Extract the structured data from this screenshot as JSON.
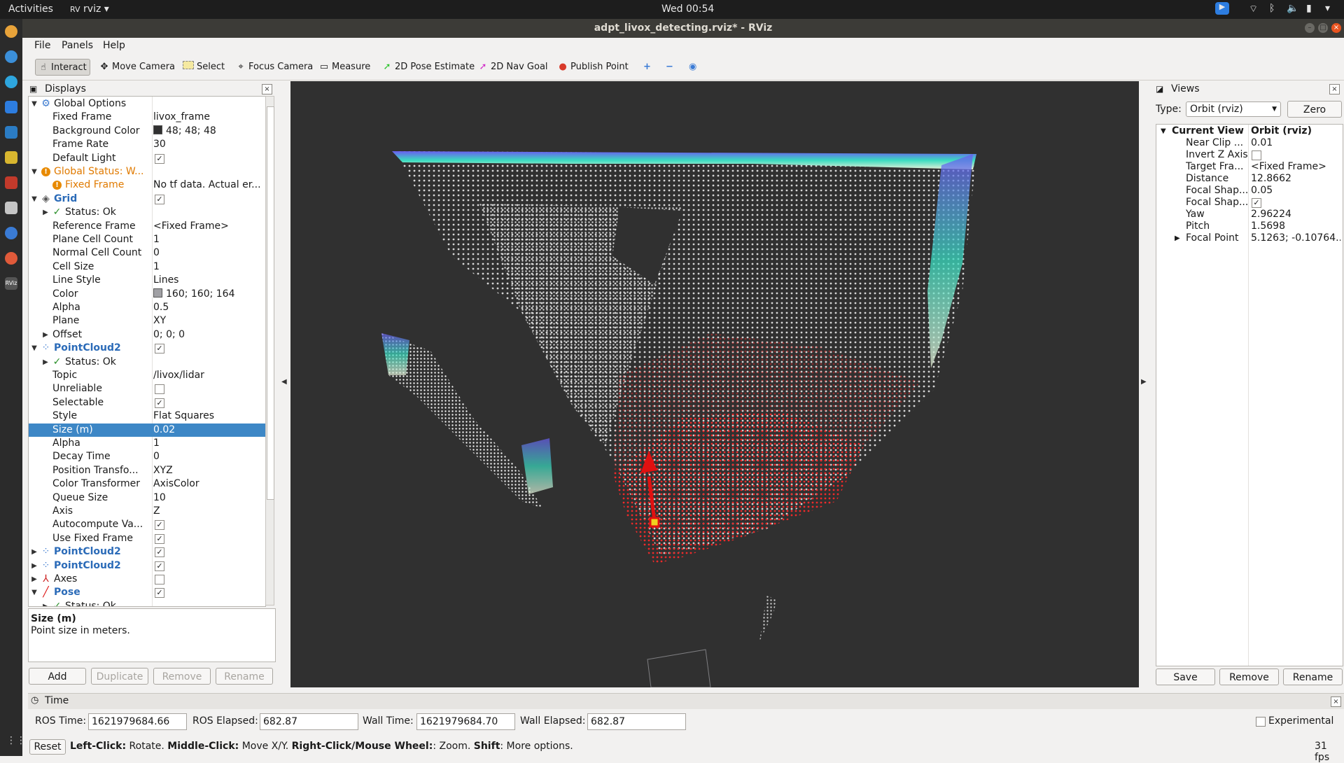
{
  "topbar": {
    "activities": "Activities",
    "app": "rviz",
    "clock": "Wed 00:54"
  },
  "window": {
    "title": "adpt_livox_detecting.rviz* - RViz"
  },
  "menu": {
    "file": "File",
    "panels": "Panels",
    "help": "Help"
  },
  "toolbar": {
    "interact": "Interact",
    "move_camera": "Move Camera",
    "select": "Select",
    "focus_camera": "Focus Camera",
    "measure": "Measure",
    "pose_estimate": "2D Pose Estimate",
    "nav_goal": "2D Nav Goal",
    "publish_point": "Publish Point"
  },
  "displays": {
    "title": "Displays",
    "rows": [
      {
        "name": "Global Options",
        "value": ""
      },
      {
        "name": "Fixed Frame",
        "value": "livox_frame"
      },
      {
        "name": "Background Color",
        "value": "48; 48; 48"
      },
      {
        "name": "Frame Rate",
        "value": "30"
      },
      {
        "name": "Default Light",
        "value": ""
      },
      {
        "name": "Global Status: W...",
        "value": ""
      },
      {
        "name": "Fixed Frame",
        "value": "No tf data.  Actual er..."
      },
      {
        "name": "Grid",
        "value": ""
      },
      {
        "name": "Status: Ok",
        "value": ""
      },
      {
        "name": "Reference Frame",
        "value": "<Fixed Frame>"
      },
      {
        "name": "Plane Cell Count",
        "value": "1"
      },
      {
        "name": "Normal Cell Count",
        "value": "0"
      },
      {
        "name": "Cell Size",
        "value": "1"
      },
      {
        "name": "Line Style",
        "value": "Lines"
      },
      {
        "name": "Color",
        "value": "160; 160; 164"
      },
      {
        "name": "Alpha",
        "value": "0.5"
      },
      {
        "name": "Plane",
        "value": "XY"
      },
      {
        "name": "Offset",
        "value": "0; 0; 0"
      },
      {
        "name": "PointCloud2",
        "value": ""
      },
      {
        "name": "Status: Ok",
        "value": ""
      },
      {
        "name": "Topic",
        "value": "/livox/lidar"
      },
      {
        "name": "Unreliable",
        "value": ""
      },
      {
        "name": "Selectable",
        "value": ""
      },
      {
        "name": "Style",
        "value": "Flat Squares"
      },
      {
        "name": "Size (m)",
        "value": "0.02"
      },
      {
        "name": "Alpha",
        "value": "1"
      },
      {
        "name": "Decay Time",
        "value": "0"
      },
      {
        "name": "Position Transfo...",
        "value": "XYZ"
      },
      {
        "name": "Color Transformer",
        "value": "AxisColor"
      },
      {
        "name": "Queue Size",
        "value": "10"
      },
      {
        "name": "Axis",
        "value": "Z"
      },
      {
        "name": "Autocompute Va...",
        "value": ""
      },
      {
        "name": "Use Fixed Frame",
        "value": ""
      },
      {
        "name": "PointCloud2",
        "value": ""
      },
      {
        "name": "PointCloud2",
        "value": ""
      },
      {
        "name": "Axes",
        "value": ""
      },
      {
        "name": "Pose",
        "value": ""
      },
      {
        "name": "Status: Ok",
        "value": ""
      }
    ],
    "desc_title": "Size (m)",
    "desc_text": "Point size in meters.",
    "buttons": {
      "add": "Add",
      "duplicate": "Duplicate",
      "remove": "Remove",
      "rename": "Rename"
    }
  },
  "views": {
    "title": "Views",
    "type_label": "Type:",
    "type_value": "Orbit (rviz)",
    "zero": "Zero",
    "header_name": "Current View",
    "header_value": "Orbit (rviz)",
    "rows": [
      {
        "name": "Near Clip ...",
        "value": "0.01"
      },
      {
        "name": "Invert Z Axis",
        "value": ""
      },
      {
        "name": "Target Fra...",
        "value": "<Fixed Frame>"
      },
      {
        "name": "Distance",
        "value": "12.8662"
      },
      {
        "name": "Focal Shap...",
        "value": "0.05"
      },
      {
        "name": "Focal Shap...",
        "value": ""
      },
      {
        "name": "Yaw",
        "value": "2.96224"
      },
      {
        "name": "Pitch",
        "value": "1.5698"
      },
      {
        "name": "Focal Point",
        "value": "5.1263; -0.10764..."
      }
    ],
    "buttons": {
      "save": "Save",
      "remove": "Remove",
      "rename": "Rename"
    }
  },
  "time": {
    "title": "Time",
    "ros_time_label": "ROS Time:",
    "ros_time": "1621979684.66",
    "ros_elapsed_label": "ROS Elapsed:",
    "ros_elapsed": "682.87",
    "wall_time_label": "Wall Time:",
    "wall_time": "1621979684.70",
    "wall_elapsed_label": "Wall Elapsed:",
    "wall_elapsed": "682.87",
    "experimental": "Experimental"
  },
  "status": {
    "reset": "Reset",
    "l1": "Left-Click:",
    "t1": " Rotate. ",
    "l2": "Middle-Click:",
    "t2": " Move X/Y. ",
    "l3": "Right-Click/Mouse Wheel:",
    "t3": ": Zoom. ",
    "l4": "Shift",
    "t4": ": More options.",
    "fps": "31 fps"
  },
  "colors": {
    "selection": "#3d87c6",
    "viewport_bg": "#303030",
    "status_warn": "#e07a00"
  }
}
